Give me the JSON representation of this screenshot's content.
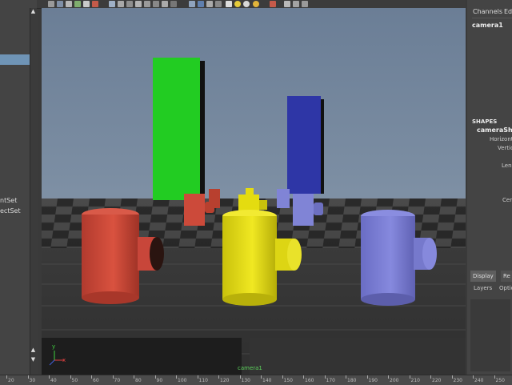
{
  "outliner": {
    "items": [
      {
        "label": "ntSet"
      },
      {
        "label": "ectSet"
      }
    ]
  },
  "channels": {
    "tabs": {
      "channels": "Channels",
      "edit": "Edi"
    },
    "node": "camera1",
    "shapes_header": "SHAPES",
    "shape_name": "cameraSha",
    "attributes": [
      {
        "label": "Horizont"
      },
      {
        "label": "Vertic"
      },
      {
        "label": "Lens"
      },
      {
        "label": "Cen"
      }
    ]
  },
  "layer_editor": {
    "tabs": {
      "display": "Display",
      "render": "Re"
    },
    "menu": {
      "layers": "Layers",
      "options": "Optio"
    }
  },
  "viewport": {
    "camera_label": "camera1",
    "colors": {
      "green": "#22cc22",
      "blue": "#2e36a6",
      "red": "#cf4b3c",
      "yellow": "#e6de14",
      "lavender": "#7b7ed4"
    },
    "axis": {
      "x": "x",
      "y": "y"
    }
  },
  "timeslider": {
    "ticks": [
      "20",
      "30",
      "40",
      "50",
      "60",
      "70",
      "80",
      "90",
      "100",
      "110",
      "120",
      "130",
      "140",
      "150",
      "160",
      "170",
      "180",
      "190",
      "200",
      "210",
      "220",
      "230",
      "240",
      "250"
    ]
  }
}
